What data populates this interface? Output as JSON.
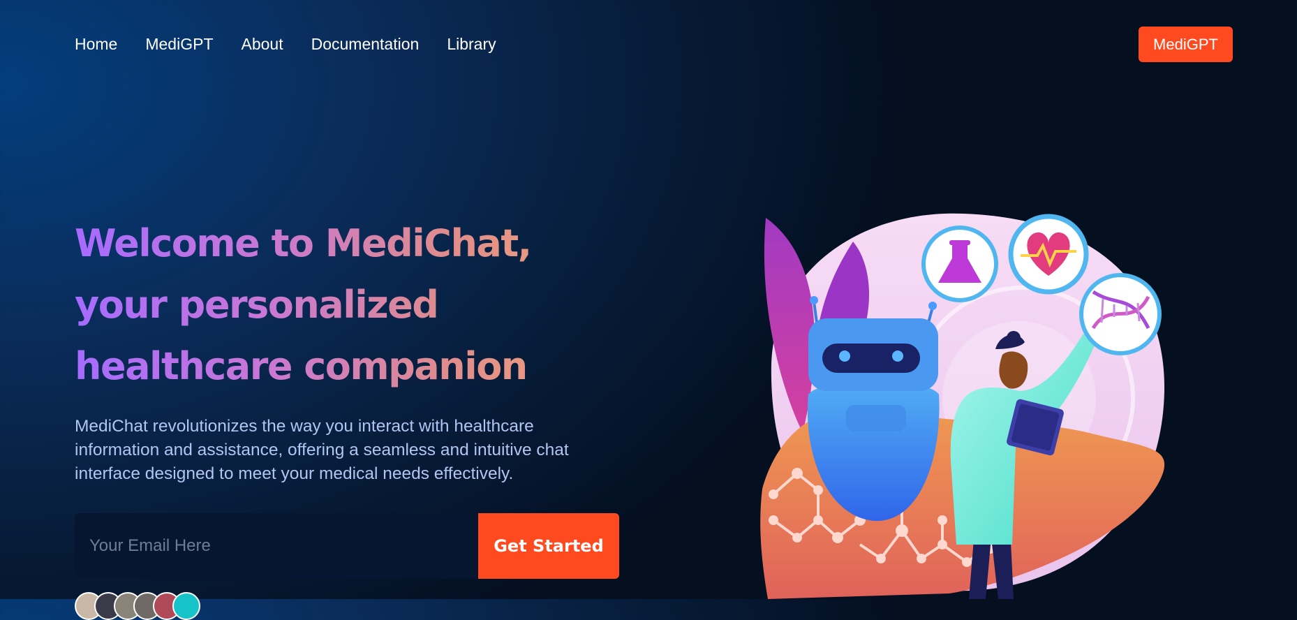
{
  "nav": {
    "links": [
      "Home",
      "MediGPT",
      "About",
      "Documentation",
      "Library"
    ],
    "cta_label": "MediGPT"
  },
  "hero": {
    "title": "Welcome to MediChat, your personalized healthcare companion",
    "description": "MediChat revolutionizes the way you interact with healthcare information and assistance, offering a seamless and intuitive chat interface designed to meet your medical needs effectively.",
    "email_placeholder": "Your Email Here",
    "cta_label": "Get Started"
  },
  "illustration": {
    "icons": [
      "flask-icon",
      "heartbeat-icon",
      "dna-icon"
    ]
  },
  "colors": {
    "accent": "#ff4a20",
    "background_dark": "#040f20",
    "background_light": "#033e7d",
    "title_gradient_start": "#a66bff",
    "title_gradient_end": "#f2a37a",
    "description": "#b2c5f2"
  }
}
